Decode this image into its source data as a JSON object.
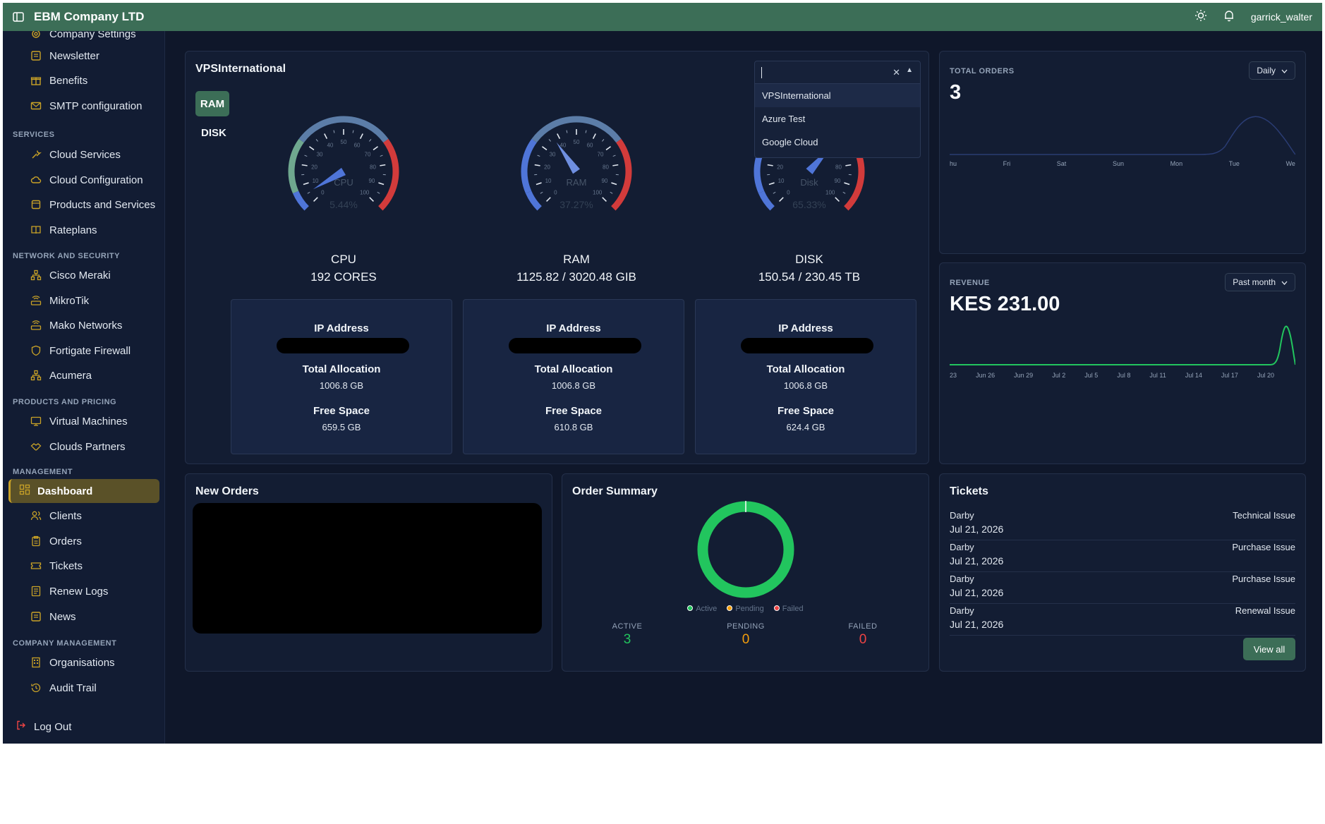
{
  "topbar": {
    "company": "EBM Company LTD",
    "username": "garrick_walter"
  },
  "sidebar": {
    "company_items": [
      {
        "label": "Company Settings",
        "icon": "gear-icon"
      },
      {
        "label": "Newsletter",
        "icon": "newspaper-icon"
      },
      {
        "label": "Benefits",
        "icon": "gift-icon"
      },
      {
        "label": "SMTP configuration",
        "icon": "mail-icon"
      }
    ],
    "sections": {
      "services": "SERVICES",
      "network": "NETWORK AND SECURITY",
      "products": "PRODUCTS AND PRICING",
      "management": "MANAGEMENT",
      "company_management": "COMPANY MANAGEMENT"
    },
    "services": [
      {
        "label": "Cloud Services",
        "icon": "wrench-icon"
      },
      {
        "label": "Cloud Configuration",
        "icon": "cloud-icon"
      },
      {
        "label": "Products and Services",
        "icon": "package-icon"
      },
      {
        "label": "Rateplans",
        "icon": "book-icon"
      }
    ],
    "network": [
      {
        "label": "Cisco Meraki",
        "icon": "network-icon"
      },
      {
        "label": "MikroTik",
        "icon": "router-icon"
      },
      {
        "label": "Mako Networks",
        "icon": "router-icon"
      },
      {
        "label": "Fortigate Firewall",
        "icon": "shield-icon"
      },
      {
        "label": "Acumera",
        "icon": "network-icon"
      }
    ],
    "products": [
      {
        "label": "Virtual Machines",
        "icon": "monitor-icon"
      },
      {
        "label": "Clouds Partners",
        "icon": "handshake-icon"
      }
    ],
    "management": {
      "active": "Dashboard",
      "items": [
        {
          "label": "Clients",
          "icon": "users-icon"
        },
        {
          "label": "Orders",
          "icon": "clipboard-icon"
        },
        {
          "label": "Tickets",
          "icon": "ticket-icon"
        },
        {
          "label": "Renew Logs",
          "icon": "log-icon"
        },
        {
          "label": "News",
          "icon": "newspaper-icon"
        }
      ]
    },
    "company_management": [
      {
        "label": "Organisations",
        "icon": "building-icon"
      },
      {
        "label": "Audit Trail",
        "icon": "history-icon"
      }
    ],
    "logout": "Log Out"
  },
  "vps": {
    "title": "VPSInternational",
    "tabs": [
      "RAM",
      "DISK"
    ],
    "gauges": [
      {
        "label": "CPU",
        "percent_text": "5.44%",
        "value": 5.44,
        "needle_color": "#4f75d8",
        "ticks": [
          "0",
          "10",
          "20",
          "30",
          "40",
          "50",
          "60",
          "70",
          "80",
          "90",
          "100"
        ]
      },
      {
        "label": "RAM",
        "percent_text": "37.27%",
        "value": 37.27,
        "needle_color": "#6f8fe0",
        "ticks": [
          "0",
          "10",
          "20",
          "30",
          "40",
          "50",
          "60",
          "70",
          "80",
          "90",
          "100"
        ]
      },
      {
        "label": "Disk",
        "percent_text": "65.33%",
        "value": 65.33,
        "needle_color": "#4f75d8",
        "ticks": [
          "0",
          "10",
          "20",
          "30",
          "40",
          "50",
          "60",
          "70",
          "80",
          "90",
          "100"
        ]
      }
    ],
    "metrics": [
      {
        "name": "CPU",
        "value": "192 CORES"
      },
      {
        "name": "RAM",
        "value": "1125.82 / 3020.48 GIB"
      },
      {
        "name": "DISK",
        "value": "150.54 / 230.45 TB"
      }
    ],
    "boxes": [
      {
        "ip_label": "IP Address",
        "alloc_label": "Total Allocation",
        "alloc": "1006.8 GB",
        "free_label": "Free Space",
        "free": "659.5 GB"
      },
      {
        "ip_label": "IP Address",
        "alloc_label": "Total Allocation",
        "alloc": "1006.8 GB",
        "free_label": "Free Space",
        "free": "610.8 GB"
      },
      {
        "ip_label": "IP Address",
        "alloc_label": "Total Allocation",
        "alloc": "1006.8 GB",
        "free_label": "Free Space",
        "free": "624.4 GB"
      }
    ],
    "dropdown": {
      "value": "",
      "options": [
        "VPSInternational",
        "Azure Test",
        "Google Cloud"
      ],
      "highlighted": "VPSInternational"
    }
  },
  "total_orders": {
    "caption": "TOTAL ORDERS",
    "value": "3",
    "period": "Daily",
    "axis": [
      "hu",
      "Fri",
      "Sat",
      "Sun",
      "Mon",
      "Tue",
      "We"
    ]
  },
  "revenue": {
    "caption": "REVENUE",
    "value": "KES 231.00",
    "period": "Past month",
    "axis": [
      "23",
      "Jun 26",
      "Jun 29",
      "Jul 2",
      "Jul 5",
      "Jul 8",
      "Jul 11",
      "Jul 14",
      "Jul 17",
      "Jul 20"
    ]
  },
  "new_orders": {
    "title": "New Orders"
  },
  "order_summary": {
    "title": "Order Summary",
    "legend": [
      "Active",
      "Pending",
      "Failed"
    ],
    "colors": {
      "active": "#22c55e",
      "pending": "#f59e0b",
      "failed": "#ef4444"
    },
    "stats": [
      {
        "label": "ACTIVE",
        "value": "3"
      },
      {
        "label": "PENDING",
        "value": "0"
      },
      {
        "label": "FAILED",
        "value": "0"
      }
    ]
  },
  "tickets": {
    "title": "Tickets",
    "items": [
      {
        "name": "Darby",
        "date": "Jul 21, 2026",
        "type": "Technical Issue"
      },
      {
        "name": "Darby",
        "date": "Jul 21, 2026",
        "type": "Purchase Issue"
      },
      {
        "name": "Darby",
        "date": "Jul 21, 2026",
        "type": "Purchase Issue"
      },
      {
        "name": "Darby",
        "date": "Jul 21, 2026",
        "type": "Renewal Issue"
      }
    ],
    "view_all": "View all"
  },
  "colors": {
    "brand": "#3c6e57",
    "accent": "#c9a227",
    "background": "#0f172a"
  }
}
